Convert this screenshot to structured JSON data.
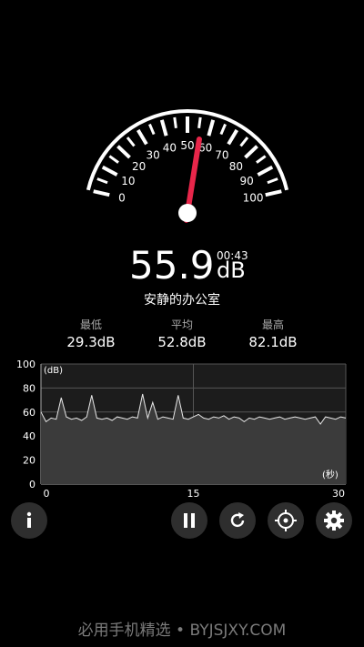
{
  "meter": {
    "value": "55.9",
    "unit": "dB",
    "time": "00:43",
    "environment": "安静的办公室",
    "needle_db": 55.9,
    "scale_labels": [
      "0",
      "10",
      "20",
      "30",
      "40",
      "50",
      "60",
      "70",
      "80",
      "90",
      "100"
    ],
    "accent": "#e8264a"
  },
  "stats": {
    "min_label": "最低",
    "min_value": "29.3dB",
    "avg_label": "平均",
    "avg_value": "52.8dB",
    "max_label": "最高",
    "max_value": "82.1dB"
  },
  "chart_data": {
    "type": "line",
    "ylabel": "(dB)",
    "xlabel": "(秒)",
    "y_ticks": [
      "0",
      "20",
      "40",
      "60",
      "80",
      "100"
    ],
    "x_ticks": [
      "0",
      "15",
      "30"
    ],
    "ylim": [
      0,
      100
    ],
    "xlim": [
      0,
      30
    ],
    "series": [
      {
        "x": [
          0,
          0.5,
          1,
          1.5,
          2,
          2.5,
          3,
          3.5,
          4,
          4.5,
          5,
          5.5,
          6,
          6.5,
          7,
          7.5,
          8,
          8.5,
          9,
          9.5,
          10,
          10.5,
          11,
          11.5,
          12,
          12.5,
          13,
          13.5,
          14,
          14.5,
          15,
          15.5,
          16,
          16.5,
          17,
          17.5,
          18,
          18.5,
          19,
          19.5,
          20,
          20.5,
          21,
          21.5,
          22,
          22.5,
          23,
          23.5,
          24,
          24.5,
          25,
          25.5,
          26,
          26.5,
          27,
          27.5,
          28,
          28.5,
          29,
          29.5,
          30
        ],
        "values": [
          60,
          52,
          55,
          54,
          72,
          56,
          54,
          55,
          53,
          56,
          74,
          55,
          54,
          55,
          53,
          56,
          55,
          54,
          56,
          55,
          75,
          55,
          68,
          54,
          56,
          55,
          54,
          74,
          55,
          54,
          56,
          58,
          55,
          54,
          56,
          55,
          57,
          54,
          56,
          55,
          52,
          55,
          54,
          56,
          55,
          54,
          55,
          56,
          54,
          55,
          56,
          55,
          54,
          55,
          56,
          50,
          56,
          55,
          54,
          56,
          55
        ]
      }
    ]
  },
  "buttons": [
    "info-icon",
    "pause-icon",
    "reset-icon",
    "calibrate-icon",
    "settings-icon"
  ],
  "watermark": "必用手机精选 • BYJSJXY.COM"
}
